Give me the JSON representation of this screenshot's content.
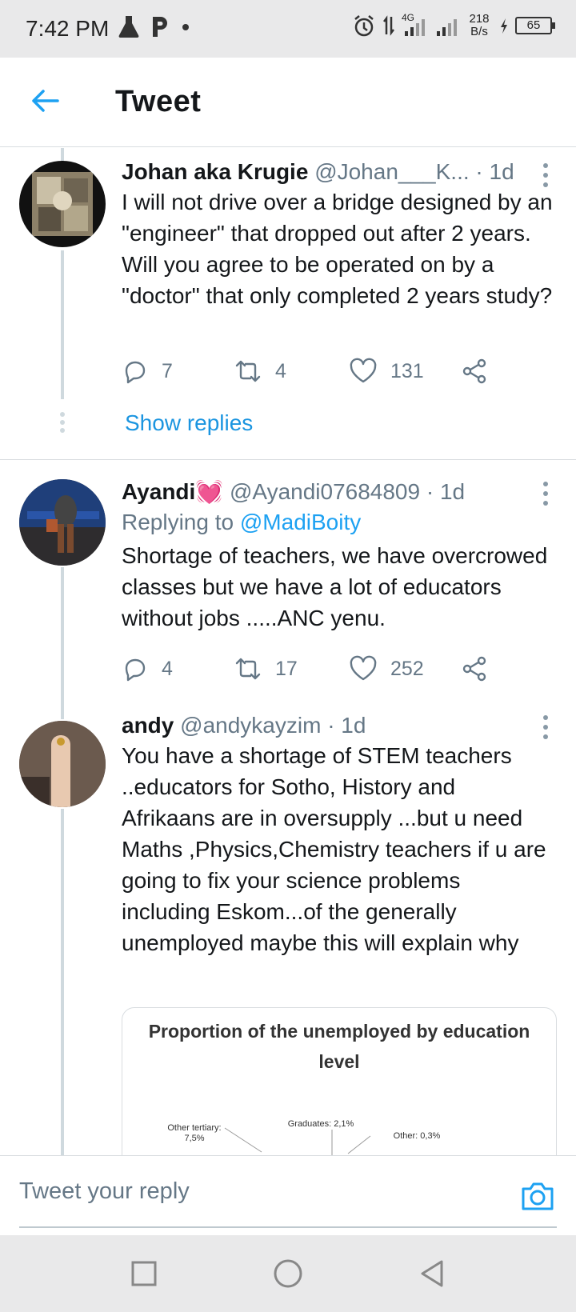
{
  "status_bar": {
    "time": "7:42 PM",
    "net_type": "4G",
    "net_speed_value": "218",
    "net_speed_unit": "B/s",
    "battery": "65"
  },
  "header": {
    "title": "Tweet"
  },
  "tweets": [
    {
      "name": "Johan aka Krugie",
      "handle": "@Johan___K...",
      "time": "1d",
      "text": "I will not drive over a bridge designed by an \"engineer\" that dropped out after 2 years. Will you agree to be operated on by a \"doctor\" that only completed 2 years study?",
      "replies": "7",
      "retweets": "4",
      "likes": "131",
      "show_replies": "Show replies"
    },
    {
      "name": "Ayandi",
      "name_emoji": "💓",
      "handle": "@Ayandi07684809",
      "time": "1d",
      "replying_prefix": "Replying to",
      "replying_to": "@MadiBoity",
      "text": "Shortage of teachers, we have overcrowed classes but we have a lot of educators without jobs .....ANC yenu.",
      "replies": "4",
      "retweets": "17",
      "likes": "252"
    },
    {
      "name": "andy",
      "handle": "@andykayzim",
      "time": "1d",
      "text": "You have a shortage of STEM teachers ..educators for Sotho, History and Afrikaans are in oversupply ...but u need Maths ,Physics,Chemistry teachers if u are going to fix your science problems including Eskom...of the generally unemployed maybe this will explain why",
      "image": {
        "title": "Proportion of the unemployed by education level",
        "labels": {
          "other_tertiary": "Other tertiary:",
          "other_tertiary_value": "7,5%",
          "graduates": "Graduates: 2,1%",
          "other": "Other: 0,3%"
        }
      }
    }
  ],
  "reply_bar": {
    "placeholder": "Tweet your reply"
  },
  "colors": {
    "accent": "#1da1f2",
    "muted": "#657786",
    "text": "#14171a"
  }
}
